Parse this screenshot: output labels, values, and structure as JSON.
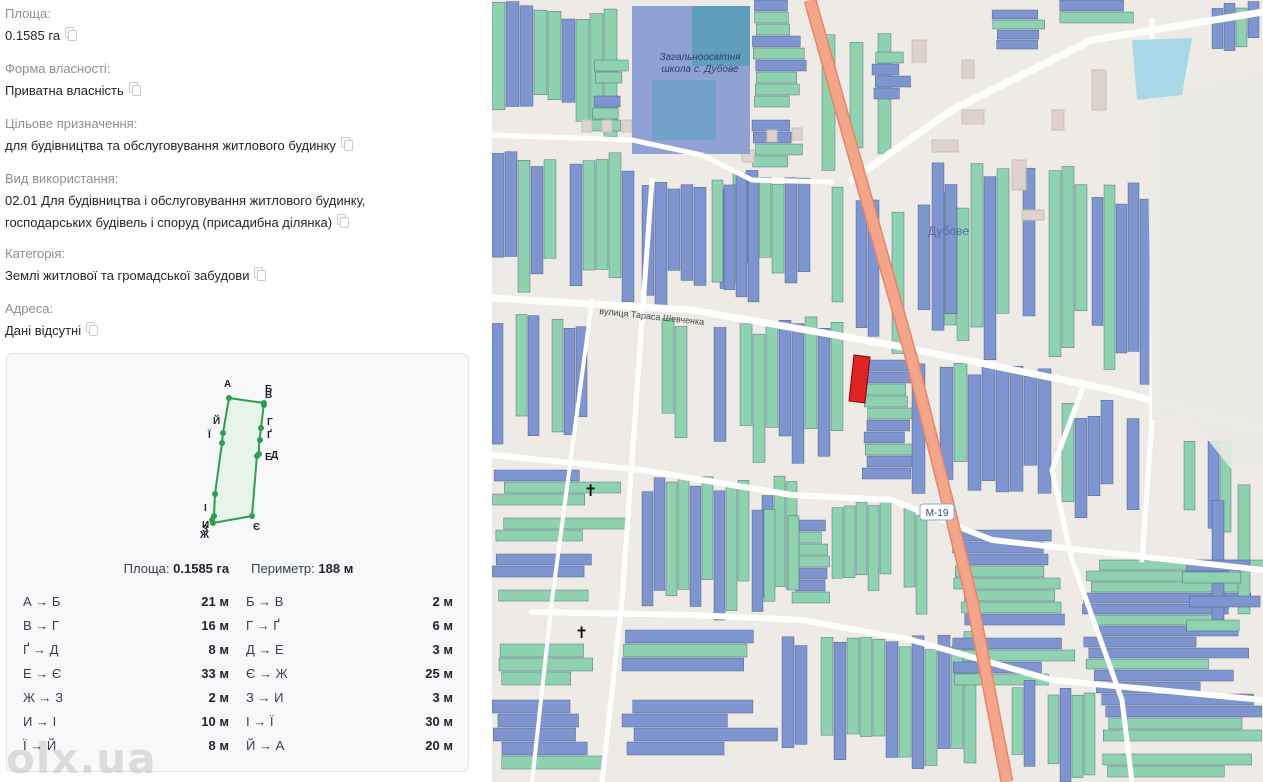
{
  "fields": [
    {
      "label": "Площа:",
      "value": "0.1585 га"
    },
    {
      "label": "Форма власності:",
      "value": "Приватна власність"
    },
    {
      "label": "Цільове призначення:",
      "value": "для будівництва та обслуговування житлового будинку"
    },
    {
      "label": "Вид використання:",
      "value": "02.01 Для будівництва і обслуговування житлового будинку,",
      "value2": "господарських будівель і споруд (присадибна ділянка)"
    },
    {
      "label": "Категорія:",
      "value": "Землі житлової та громадської забудови"
    },
    {
      "label": "Адреса:",
      "value": "Дані відсутні"
    }
  ],
  "plot": {
    "vertex_labels": [
      "А",
      "Б",
      "В",
      "Г",
      "Ґ",
      "Д",
      "Е",
      "Є",
      "Ж",
      "З",
      "И",
      "І",
      "Ї",
      "Й"
    ],
    "colors": {
      "outline": "#2e9e4f",
      "fill": "#e6f4ea"
    }
  },
  "summary": {
    "area_label": "Площа:",
    "area_value": "0.1585 га",
    "perimeter_label": "Периметр:",
    "perimeter_value": "188 м"
  },
  "segments": [
    {
      "label": "А → Б",
      "value": "21 м"
    },
    {
      "label": "Б → В",
      "value": "2 м"
    },
    {
      "label": "В → Г",
      "value": "16 м"
    },
    {
      "label": "Г → Ґ",
      "value": "6 м"
    },
    {
      "label": "Ґ → Д",
      "value": "8 м"
    },
    {
      "label": "Д → Е",
      "value": "3 м"
    },
    {
      "label": "Е → Є",
      "value": "33 м"
    },
    {
      "label": "Є → Ж",
      "value": "25 м"
    },
    {
      "label": "Ж → З",
      "value": "2 м"
    },
    {
      "label": "З → И",
      "value": "3 м"
    },
    {
      "label": "И → І",
      "value": "10 м"
    },
    {
      "label": "І → Ї",
      "value": "30 м"
    },
    {
      "label": "Ї → Й",
      "value": "8 м"
    },
    {
      "label": "Й → А",
      "value": "20 м"
    }
  ],
  "watermark": "olx.ua",
  "map": {
    "school_label": "Загальноосвітня школа с. Дубове",
    "village_label": "Дубове",
    "street_label": "вулиця Тараса Шевченка",
    "road_badge": "М-19",
    "colors": {
      "green": "#8fd2b0",
      "blue": "#7f95cf",
      "selected": "#e02424",
      "highway": "#f4a58a"
    }
  }
}
